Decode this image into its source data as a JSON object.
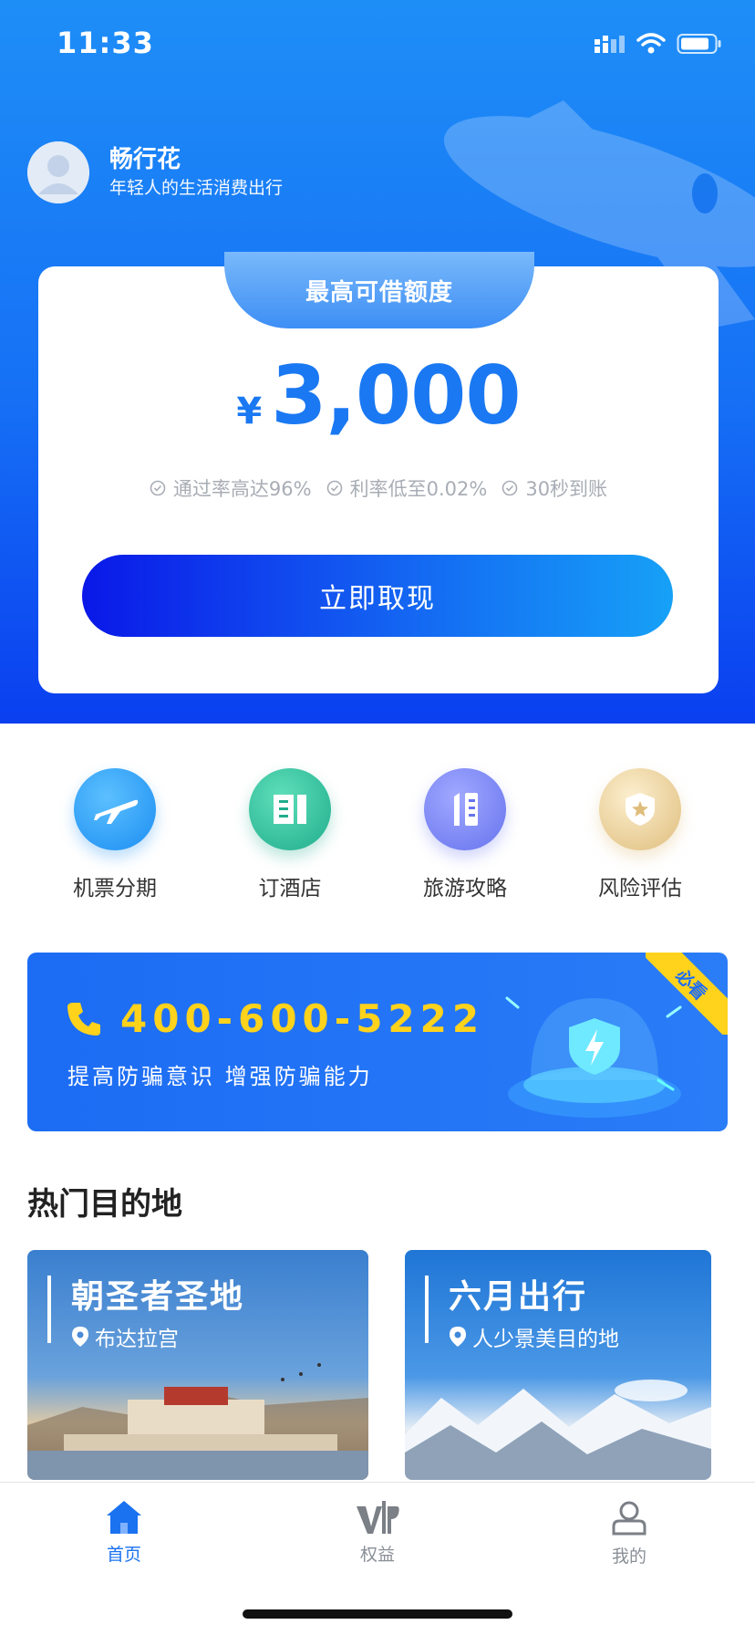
{
  "status_bar": {
    "time": "11:33"
  },
  "profile": {
    "name": "畅行花",
    "tagline": "年轻人的生活消费出行"
  },
  "loan_card": {
    "tab_label": "最高可借额度",
    "currency": "¥",
    "amount": "3,000",
    "features": [
      "通过率高达96%",
      "利率低至0.02%",
      "30秒到账"
    ],
    "cta_label": "立即取现"
  },
  "quick_menu": [
    {
      "label": "机票分期",
      "icon": "airplane-icon",
      "color": "#2e9df5"
    },
    {
      "label": "订酒店",
      "icon": "hotel-icon",
      "color": "#2fbf9f"
    },
    {
      "label": "旅游攻略",
      "icon": "guide-icon",
      "color": "#7b86f2"
    },
    {
      "label": "风险评估",
      "icon": "shield-star-icon",
      "color": "#e5c98f"
    }
  ],
  "banner": {
    "phone": "400-600-5222",
    "slogan": "提高防骗意识  增强防骗能力",
    "ribbon": "必看",
    "accent_color": "#ffd21c"
  },
  "hot_destinations": {
    "title": "热门目的地",
    "items": [
      {
        "title": "朝圣者圣地",
        "subtitle": "布达拉宫"
      },
      {
        "title": "六月出行",
        "subtitle": "人少景美目的地"
      }
    ]
  },
  "tabbar": {
    "items": [
      {
        "label": "首页",
        "icon": "home-icon",
        "active": true
      },
      {
        "label": "权益",
        "icon": "vip-icon",
        "active": false
      },
      {
        "label": "我的",
        "icon": "profile-icon",
        "active": false
      }
    ],
    "active_color": "#1a72f0"
  }
}
